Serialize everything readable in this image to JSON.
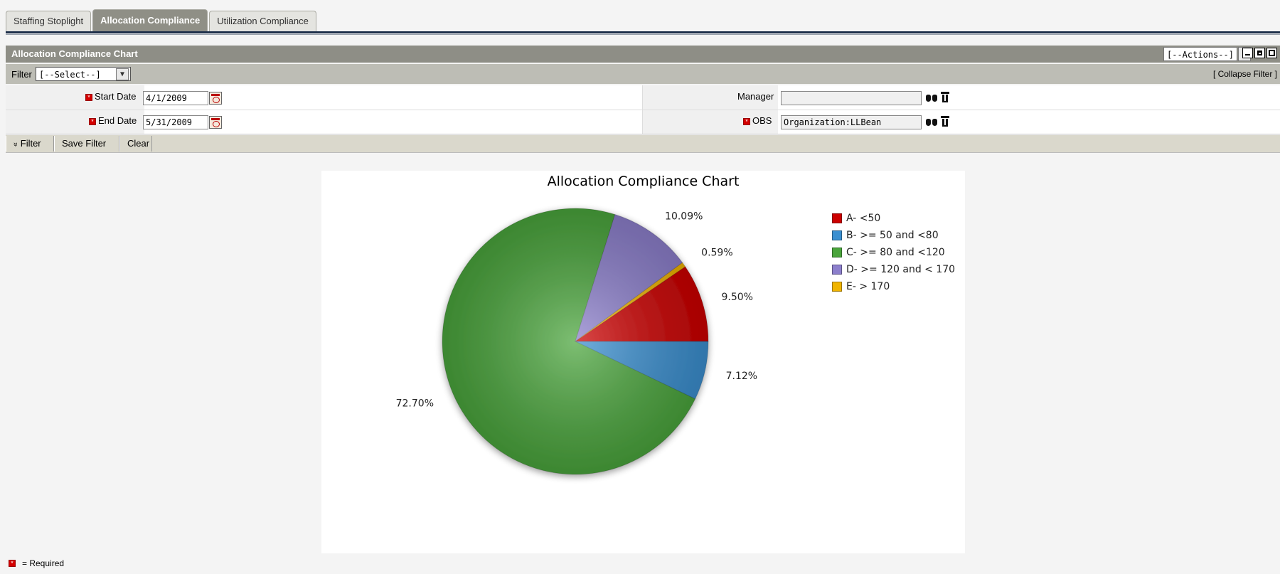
{
  "tabs": [
    {
      "label": "Staffing Stoplight",
      "active": false
    },
    {
      "label": "Allocation Compliance",
      "active": true
    },
    {
      "label": "Utilization Compliance",
      "active": false
    }
  ],
  "portlet": {
    "title": "Allocation Compliance Chart",
    "actions_value": "[--Actions--]"
  },
  "filter": {
    "label": "Filter",
    "select_value": "[--Select--]",
    "collapse_label": "[ Collapse Filter ]",
    "start_date_label": "Start Date",
    "start_date_value": "4/1/2009",
    "end_date_label": "End Date",
    "end_date_value": "5/31/2009",
    "manager_label": "Manager",
    "manager_value": "",
    "obs_label": "OBS",
    "obs_value": "Organization:LLBean",
    "buttons": {
      "filter": "Filter",
      "save_filter": "Save Filter",
      "clear": "Clear"
    },
    "filter_chevron": "«"
  },
  "required_note": "= Required",
  "required_mark": "*",
  "chart_data": {
    "type": "pie",
    "title": "Allocation Compliance Chart",
    "categories": [
      "A- <50",
      "B- >= 50 and <80",
      "C- >= 80 and <120",
      "D- >= 120 and < 170",
      "E- > 170"
    ],
    "values": [
      9.5,
      7.12,
      72.7,
      10.09,
      0.59
    ],
    "value_labels": [
      "9.50%",
      "7.12%",
      "72.70%",
      "10.09%",
      "0.59%"
    ],
    "colors": [
      "#cc0000",
      "#3a8fd0",
      "#4aa53c",
      "#8c7fcc",
      "#f0b400"
    ],
    "legend_position": "right"
  }
}
